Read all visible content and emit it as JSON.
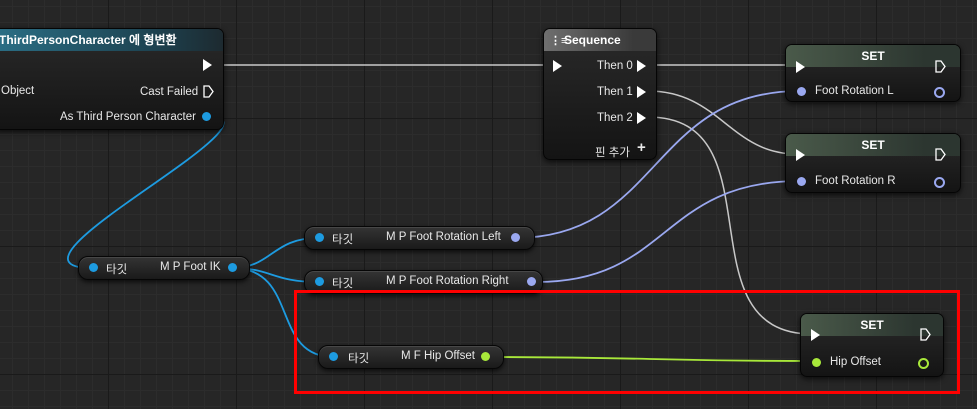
{
  "cast_node": {
    "title": "ThirdPersonCharacter 에 형변환",
    "object_label": "Object",
    "cast_failed_label": "Cast Failed",
    "as_label": "As Third Person Character"
  },
  "sequence_node": {
    "title": "Sequence",
    "outputs": [
      "Then 0",
      "Then 1",
      "Then 2"
    ],
    "add_pin_label": "핀 추가"
  },
  "set_nodes": [
    {
      "title": "SET",
      "input_label": "Foot Rotation L"
    },
    {
      "title": "SET",
      "input_label": "Foot Rotation R"
    },
    {
      "title": "SET",
      "input_label": "Hip Offset"
    }
  ],
  "getter_nodes": {
    "foot_ik": {
      "target": "타깃",
      "name": "M P Foot IK"
    },
    "rot_left": {
      "target": "타깃",
      "name": "M P Foot Rotation Left"
    },
    "rot_right": {
      "target": "타깃",
      "name": "M P Foot Rotation Right"
    },
    "hip_offset": {
      "target": "타깃",
      "name": "M F Hip Offset"
    }
  },
  "colors": {
    "object_pin": "#1d9be0",
    "rotator_pin": "#9aa8f0",
    "vector_pin": "#a8e83a",
    "exec": "#ffffff",
    "highlight": "#ff0000"
  }
}
